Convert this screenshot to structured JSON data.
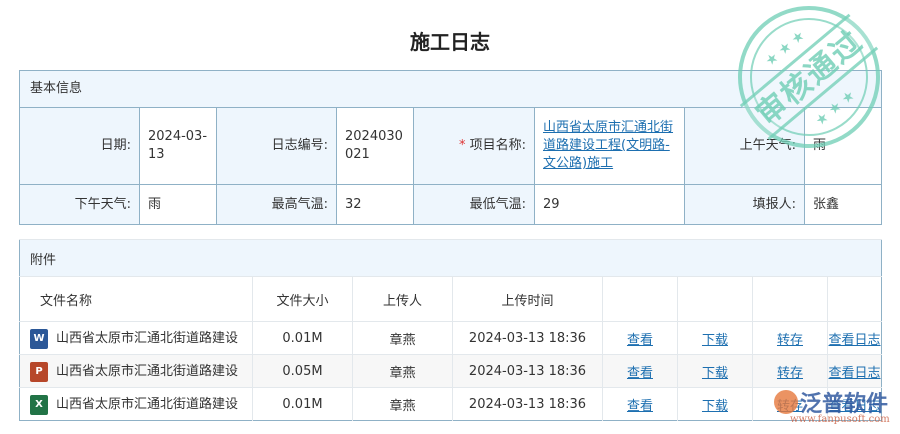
{
  "title": "施工日志",
  "basic": {
    "header": "基本信息",
    "date_label": "日期:",
    "date": "2024-03-13",
    "no_label": "日志编号:",
    "no": "2024030021",
    "project_label": "项目名称:",
    "project_required": "*",
    "project": "山西省太原市汇通北街道路建设工程(文明路-文公路)施工",
    "am_weather_label": "上午天气:",
    "am_weather": "雨",
    "pm_weather_label": "下午天气:",
    "pm_weather": "雨",
    "max_temp_label": "最高气温:",
    "max_temp": "32",
    "min_temp_label": "最低气温:",
    "min_temp": "29",
    "reporter_label": "填报人:",
    "reporter": "张鑫"
  },
  "attachments": {
    "header": "附件",
    "columns": [
      "文件名称",
      "文件大小",
      "上传人",
      "上传时间"
    ],
    "rows": [
      {
        "icon": "word-icon",
        "type": "W",
        "color": "#2b5797",
        "name": "山西省太原市汇通北街道路建设",
        "size": "0.01M",
        "uploader": "章燕",
        "time": "2024-03-13 18:36",
        "view": "查看",
        "download": "下载",
        "save": "转存",
        "log": "查看日志"
      },
      {
        "icon": "powerpoint-icon",
        "type": "P",
        "color": "#b7472a",
        "name": "山西省太原市汇通北街道路建设",
        "size": "0.05M",
        "uploader": "章燕",
        "time": "2024-03-13 18:36",
        "view": "查看",
        "download": "下载",
        "save": "转存",
        "log": "查看日志"
      },
      {
        "icon": "excel-icon",
        "type": "X",
        "color": "#217346",
        "name": "山西省太原市汇通北街道路建设",
        "size": "0.01M",
        "uploader": "章燕",
        "time": "2024-03-13 18:36",
        "view": "查看",
        "download": "下载",
        "save": "转存",
        "log": "查看日志"
      }
    ]
  },
  "stamp": "审核通过",
  "watermark": {
    "name": "泛普软件",
    "url": "www.fanpusoft.com"
  }
}
